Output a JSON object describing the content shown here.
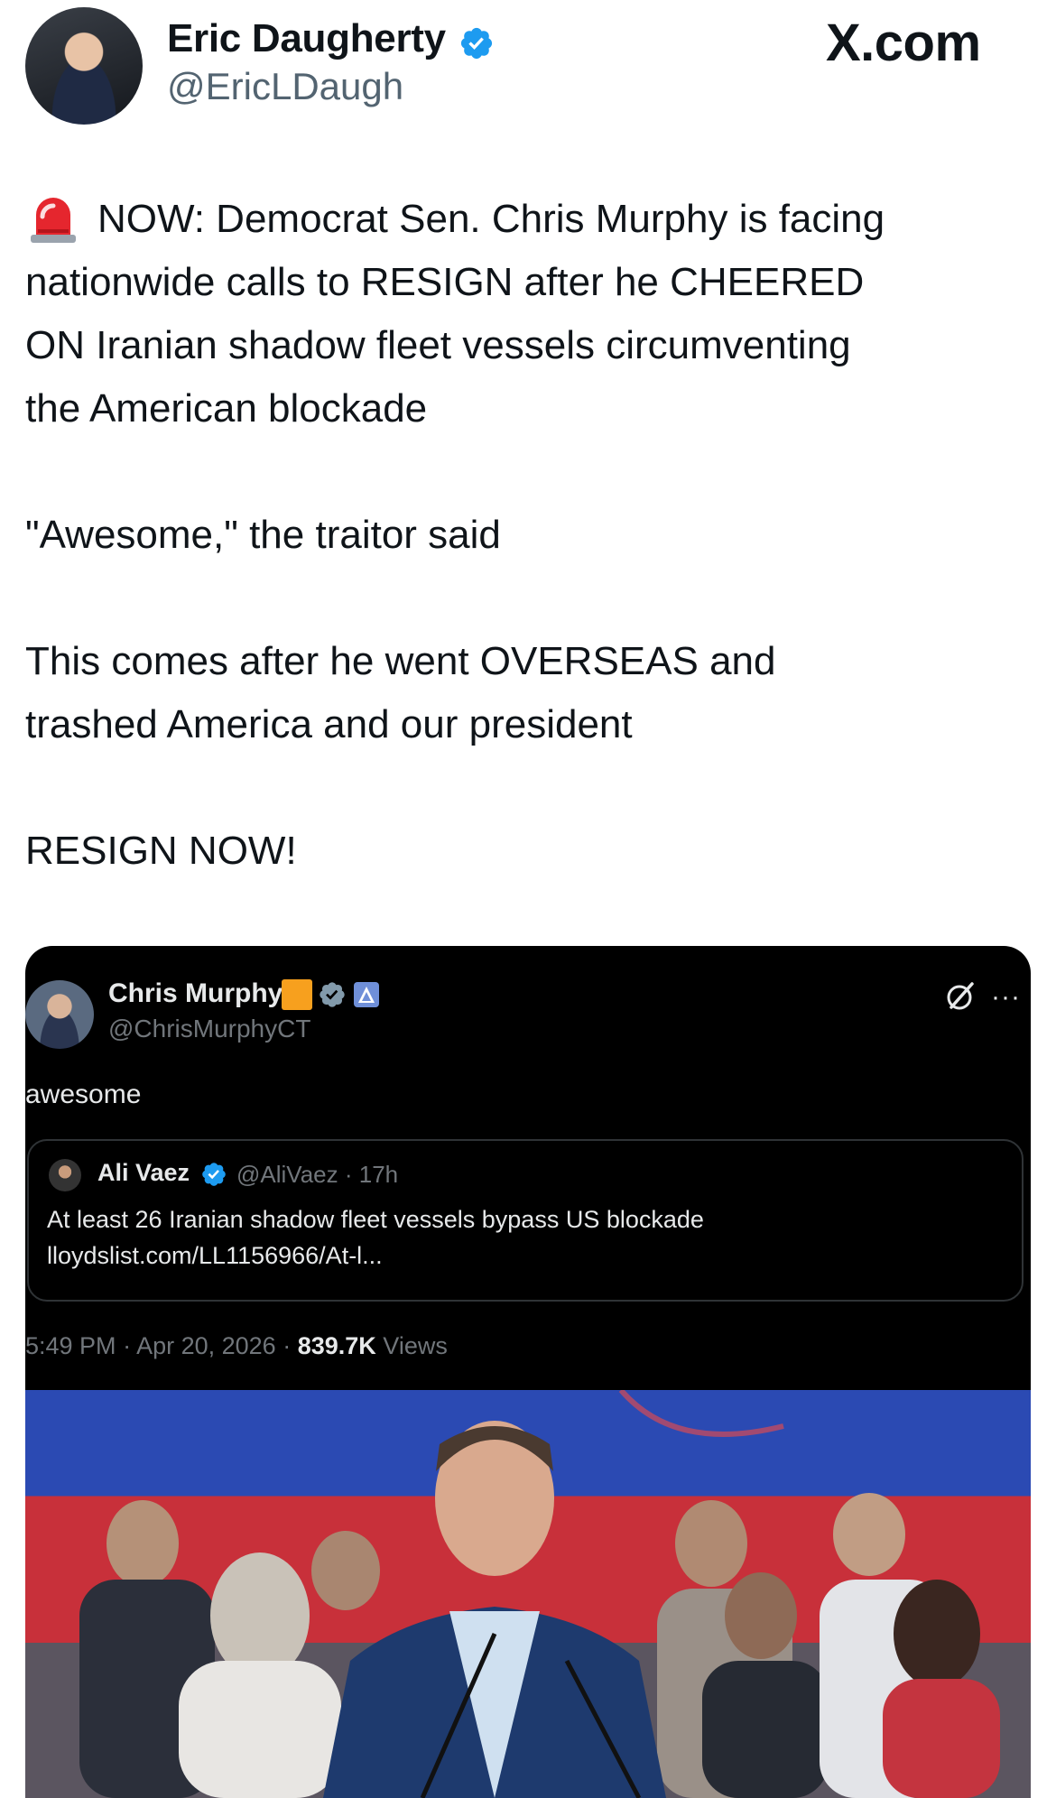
{
  "author": {
    "name": "Eric Daugherty",
    "handle": "@EricLDaugh",
    "verified": true
  },
  "site_logo": "X.com",
  "tweet": {
    "lines": [
      "NOW: Democrat Sen. Chris Murphy is facing",
      "nationwide calls to RESIGN after he CHEERED",
      "ON Iranian shadow fleet vessels circumventing",
      "the American blockade",
      "\"Awesome,\" the traitor said",
      "This comes after he went OVERSEAS and",
      "trashed America and our president",
      "RESIGN NOW!"
    ],
    "leading_icon": "police-siren-emoji"
  },
  "embedded_post": {
    "author_name": "Chris Murphy",
    "author_handle": "@ChrisMurphyCT",
    "text": "awesome",
    "quoted": {
      "author_name": "Ali Vaez",
      "author_handle": "@AliVaez",
      "age": "17h",
      "text": "At least 26 Iranian shadow fleet vessels bypass US blockade",
      "link": "lloydslist.com/LL1156966/At-l..."
    },
    "time": "5:49 PM",
    "date": "Apr 20, 2026",
    "views_count": "839.7K",
    "views_label": "Views",
    "icons": [
      "grok-icon",
      "more-icon"
    ],
    "photo": "Senator speaking at podium in front of blue and red backdrop with audience"
  },
  "colors": {
    "verified_blue": "#1d9bf0",
    "dark_bg": "#000000",
    "muted_text": "#71767b"
  }
}
